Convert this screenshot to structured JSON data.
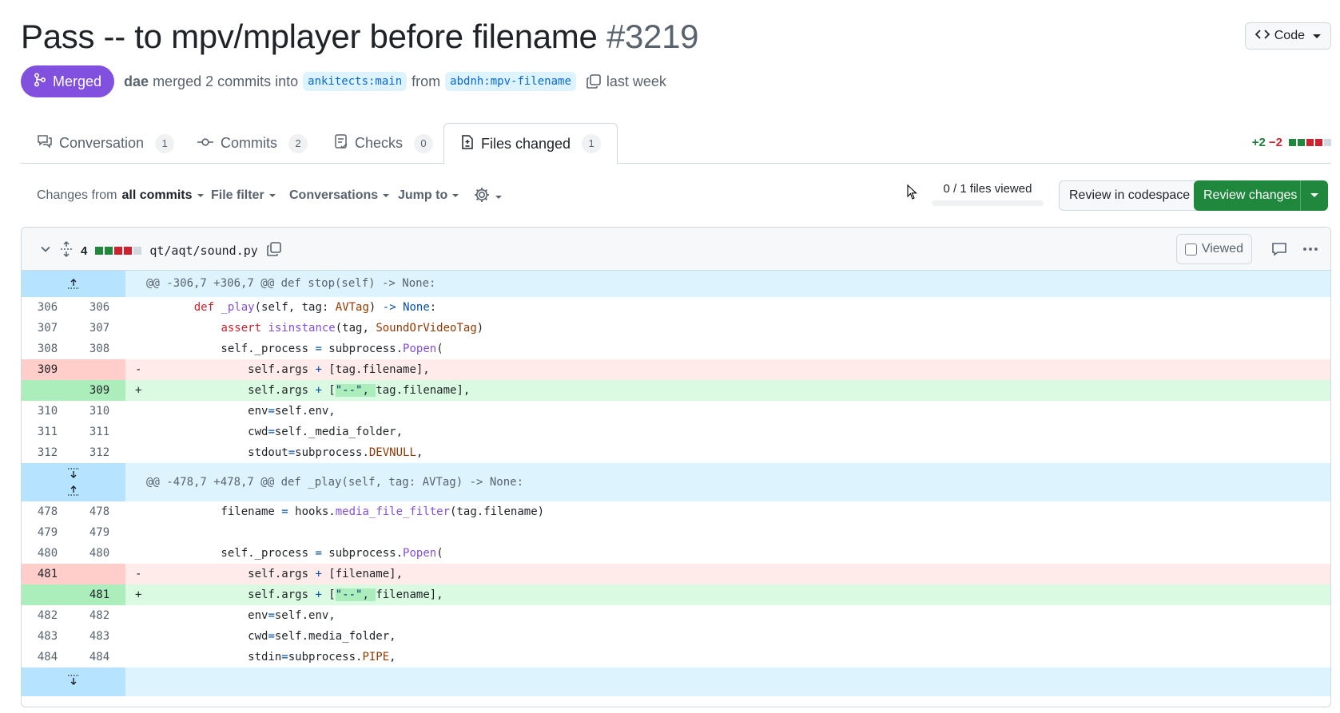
{
  "header": {
    "title": "Pass -- to mpv/mplayer before filename",
    "number": "#3219",
    "code_label": "Code"
  },
  "meta": {
    "status": "Merged",
    "author": "dae",
    "action": "merged 2 commits into",
    "base_branch": "ankitects:main",
    "from_word": "from",
    "head_branch": "abdnh:mpv-filename",
    "time": "last week"
  },
  "tabs": [
    {
      "label": "Conversation",
      "count": "1"
    },
    {
      "label": "Commits",
      "count": "2"
    },
    {
      "label": "Checks",
      "count": "0"
    },
    {
      "label": "Files changed",
      "count": "1"
    }
  ],
  "diffstat": {
    "additions": "+2",
    "deletions": "−2"
  },
  "toolbar": {
    "changes_from_prefix": "Changes from",
    "changes_from_value": "all commits",
    "file_filter": "File filter",
    "conversations": "Conversations",
    "jump_to": "Jump to",
    "files_viewed": "0 / 1 files viewed",
    "files_viewed_fraction": 0,
    "review_codespace": "Review in codespace",
    "review_changes": "Review changes"
  },
  "file": {
    "changes_count": "4",
    "path": "qt/aqt/sound.py",
    "viewed_label": "Viewed"
  },
  "hunks": {
    "h1": "@@ -306,7 +306,7 @@ def stop(self) -> None:",
    "h2": "@@ -478,7 +478,7 @@ def _play(self, tag: AVTag) -> None:"
  },
  "lines": {
    "l306": {
      "old": "306",
      "new": "306"
    },
    "l307": {
      "old": "307",
      "new": "307"
    },
    "l308": {
      "old": "308",
      "new": "308"
    },
    "l309d": {
      "old": "309",
      "new": "",
      "sign": "-"
    },
    "l309a": {
      "old": "",
      "new": "309",
      "sign": "+"
    },
    "l310": {
      "old": "310",
      "new": "310"
    },
    "l311": {
      "old": "311",
      "new": "311"
    },
    "l312": {
      "old": "312",
      "new": "312"
    },
    "l478": {
      "old": "478",
      "new": "478"
    },
    "l479": {
      "old": "479",
      "new": "479"
    },
    "l480": {
      "old": "480",
      "new": "480"
    },
    "l481d": {
      "old": "481",
      "new": "",
      "sign": "-"
    },
    "l481a": {
      "old": "",
      "new": "481",
      "sign": "+"
    },
    "l482": {
      "old": "482",
      "new": "482"
    },
    "l483": {
      "old": "483",
      "new": "483"
    },
    "l484": {
      "old": "484",
      "new": "484"
    }
  },
  "colors": {
    "merged": "#8250df",
    "primary_button": "#1f883d",
    "deletion_bg": "#ffebe9",
    "addition_bg": "#dafbe1",
    "hunk_bg": "#ddf4ff"
  }
}
